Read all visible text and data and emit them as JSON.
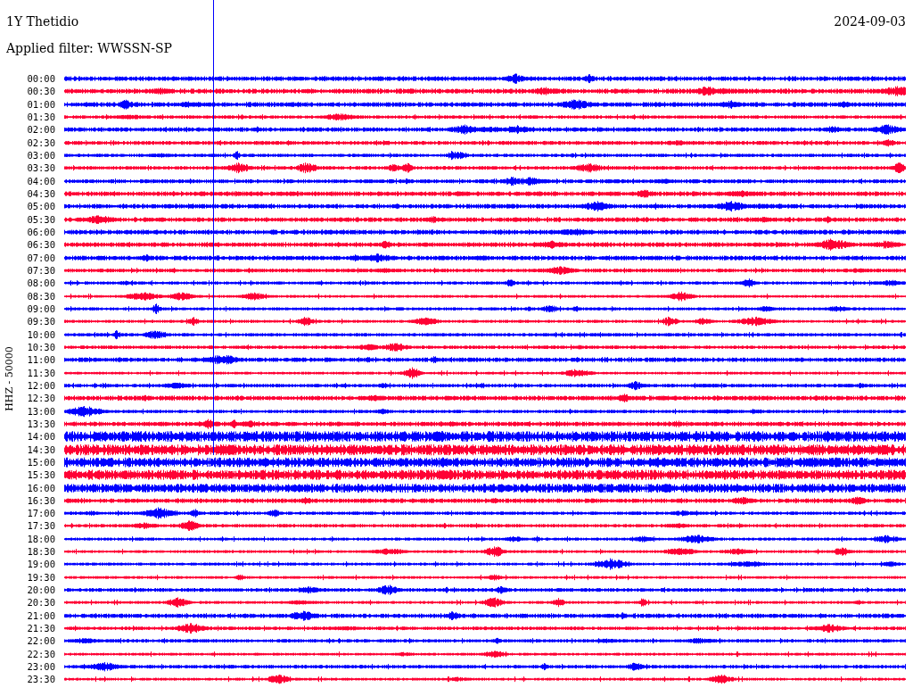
{
  "header": {
    "station": "1Y Thetidio",
    "date": "2024-09-03",
    "filter": "Applied filter: WWSSN-SP"
  },
  "axis_label": "HHZ - 50000",
  "rows": [
    {
      "time": "00:00",
      "color": "#0000ff"
    },
    {
      "time": "00:30",
      "color": "#ff0033"
    },
    {
      "time": "01:00",
      "color": "#0000ff"
    },
    {
      "time": "01:30",
      "color": "#ff0033"
    },
    {
      "time": "02:00",
      "color": "#0000ff"
    },
    {
      "time": "02:30",
      "color": "#ff0033"
    },
    {
      "time": "03:00",
      "color": "#0000ff"
    },
    {
      "time": "03:30",
      "color": "#ff0033"
    },
    {
      "time": "04:00",
      "color": "#0000ff"
    },
    {
      "time": "04:30",
      "color": "#ff0033"
    },
    {
      "time": "05:00",
      "color": "#0000ff"
    },
    {
      "time": "05:30",
      "color": "#ff0033"
    },
    {
      "time": "06:00",
      "color": "#0000ff"
    },
    {
      "time": "06:30",
      "color": "#ff0033"
    },
    {
      "time": "07:00",
      "color": "#0000ff"
    },
    {
      "time": "07:30",
      "color": "#ff0033"
    },
    {
      "time": "08:00",
      "color": "#0000ff"
    },
    {
      "time": "08:30",
      "color": "#ff0033"
    },
    {
      "time": "09:00",
      "color": "#0000ff"
    },
    {
      "time": "09:30",
      "color": "#ff0033"
    },
    {
      "time": "10:00",
      "color": "#0000ff"
    },
    {
      "time": "10:30",
      "color": "#ff0033"
    },
    {
      "time": "11:00",
      "color": "#0000ff"
    },
    {
      "time": "11:30",
      "color": "#ff0033"
    },
    {
      "time": "12:00",
      "color": "#0000ff"
    },
    {
      "time": "12:30",
      "color": "#ff0033"
    },
    {
      "time": "13:00",
      "color": "#0000ff"
    },
    {
      "time": "13:30",
      "color": "#ff0033"
    },
    {
      "time": "14:00",
      "color": "#0000ff"
    },
    {
      "time": "14:30",
      "color": "#ff0033"
    },
    {
      "time": "15:00",
      "color": "#0000ff"
    },
    {
      "time": "15:30",
      "color": "#ff0033"
    },
    {
      "time": "16:00",
      "color": "#0000ff"
    },
    {
      "time": "16:30",
      "color": "#ff0033"
    },
    {
      "time": "17:00",
      "color": "#0000ff"
    },
    {
      "time": "17:30",
      "color": "#ff0033"
    },
    {
      "time": "18:00",
      "color": "#0000ff"
    },
    {
      "time": "18:30",
      "color": "#ff0033"
    },
    {
      "time": "19:00",
      "color": "#0000ff"
    },
    {
      "time": "19:30",
      "color": "#ff0033"
    },
    {
      "time": "20:00",
      "color": "#0000ff"
    },
    {
      "time": "20:30",
      "color": "#ff0033"
    },
    {
      "time": "21:00",
      "color": "#0000ff"
    },
    {
      "time": "21:30",
      "color": "#ff0033"
    },
    {
      "time": "22:00",
      "color": "#0000ff"
    },
    {
      "time": "22:30",
      "color": "#ff0033"
    },
    {
      "time": "23:00",
      "color": "#0000ff"
    },
    {
      "time": "23:30",
      "color": "#ff0033"
    }
  ]
}
